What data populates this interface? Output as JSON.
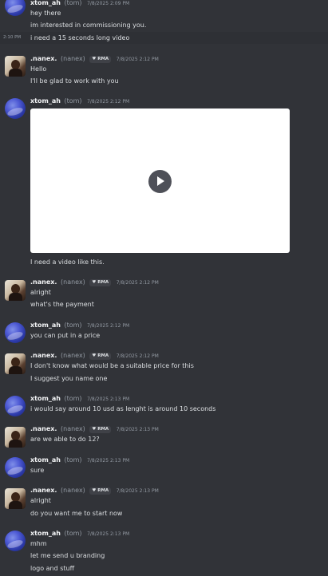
{
  "messages": {
    "m0": {
      "author": "xtom_ah",
      "handle": "(tom)",
      "timestamp": "7/8/2025 2:09 PM",
      "lines": [
        "hey there",
        "im interested in commissioning you.",
        "i need a 15 seconds long video"
      ],
      "side_time": "2:10 PM"
    },
    "m1": {
      "author": ".nanex.",
      "handle": "(nanex)",
      "badge": "RMA",
      "timestamp": "7/8/2025 2:12 PM",
      "lines": [
        "Hello",
        "I'll be glad to work with you"
      ]
    },
    "m2": {
      "author": "xtom_ah",
      "handle": "(tom)",
      "timestamp": "7/8/2025 2:12 PM",
      "lines": [
        "I need a video like this."
      ]
    },
    "m3": {
      "author": ".nanex.",
      "handle": "(nanex)",
      "badge": "RMA",
      "timestamp": "7/8/2025 2:12 PM",
      "lines": [
        "alright",
        "what's the payment"
      ]
    },
    "m4": {
      "author": "xtom_ah",
      "handle": "(tom)",
      "timestamp": "7/8/2025 2:12 PM",
      "lines": [
        "you can put in a price"
      ]
    },
    "m5": {
      "author": ".nanex.",
      "handle": "(nanex)",
      "badge": "RMA",
      "timestamp": "7/8/2025 2:12 PM",
      "lines": [
        "I don't know what would be a suitable price for this",
        "I suggest you name one"
      ]
    },
    "m6": {
      "author": "xtom_ah",
      "handle": "(tom)",
      "timestamp": "7/8/2025 2:13 PM",
      "lines": [
        "i would say around 10 usd as lenght is around 10 seconds"
      ]
    },
    "m7": {
      "author": ".nanex.",
      "handle": "(nanex)",
      "badge": "RMA",
      "timestamp": "7/8/2025 2:13 PM",
      "lines": [
        "are we able to do 12?"
      ]
    },
    "m8": {
      "author": "xtom_ah",
      "handle": "(tom)",
      "timestamp": "7/8/2025 2:13 PM",
      "lines": [
        "sure"
      ]
    },
    "m9": {
      "author": ".nanex.",
      "handle": "(nanex)",
      "badge": "RMA",
      "timestamp": "7/8/2025 2:13 PM",
      "lines": [
        "alright",
        "do you want me to start now"
      ]
    },
    "m10": {
      "author": "xtom_ah",
      "handle": "(tom)",
      "timestamp": "7/8/2025 2:13 PM",
      "lines": [
        "mhm",
        "let me send u branding",
        "logo and stuff"
      ]
    }
  },
  "icons": {
    "play": "play-icon",
    "badge": "heart-icon"
  },
  "colors": {
    "background": "#313338",
    "username": "#f2f3f5",
    "muted": "#949ba4",
    "text": "#dbdee1"
  }
}
